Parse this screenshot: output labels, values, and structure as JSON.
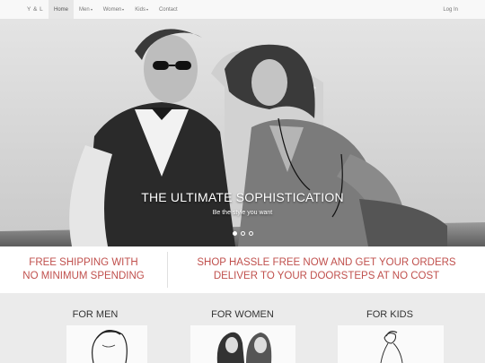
{
  "navbar": {
    "brand": "Y & L",
    "items": [
      {
        "label": "Home",
        "active": true,
        "dropdown": false
      },
      {
        "label": "Men",
        "active": false,
        "dropdown": true
      },
      {
        "label": "Women",
        "active": false,
        "dropdown": true
      },
      {
        "label": "Kids",
        "active": false,
        "dropdown": true
      },
      {
        "label": "Contact",
        "active": false,
        "dropdown": false
      }
    ],
    "login": "Log In"
  },
  "hero": {
    "title": "THE ULTIMATE SOPHISTICATION",
    "subtitle": "Be the style you want",
    "slide_count": 3,
    "active_slide": 1
  },
  "promo": {
    "left_line1": "FREE SHIPPING WITH",
    "left_line2": "NO MINIMUM SPENDING",
    "right_line1": "SHOP HASSLE FREE NOW AND GET YOUR ORDERS",
    "right_line2": "DELIVER TO YOUR DOORSTEPS AT NO COST"
  },
  "categories": [
    {
      "title": "FOR MEN"
    },
    {
      "title": "FOR WOMEN"
    },
    {
      "title": "FOR KIDS"
    }
  ],
  "colors": {
    "accent": "#c0504d",
    "navbar_bg": "#f8f8f8",
    "active_nav_bg": "#e7e7e7",
    "categories_bg": "#ebebeb"
  }
}
